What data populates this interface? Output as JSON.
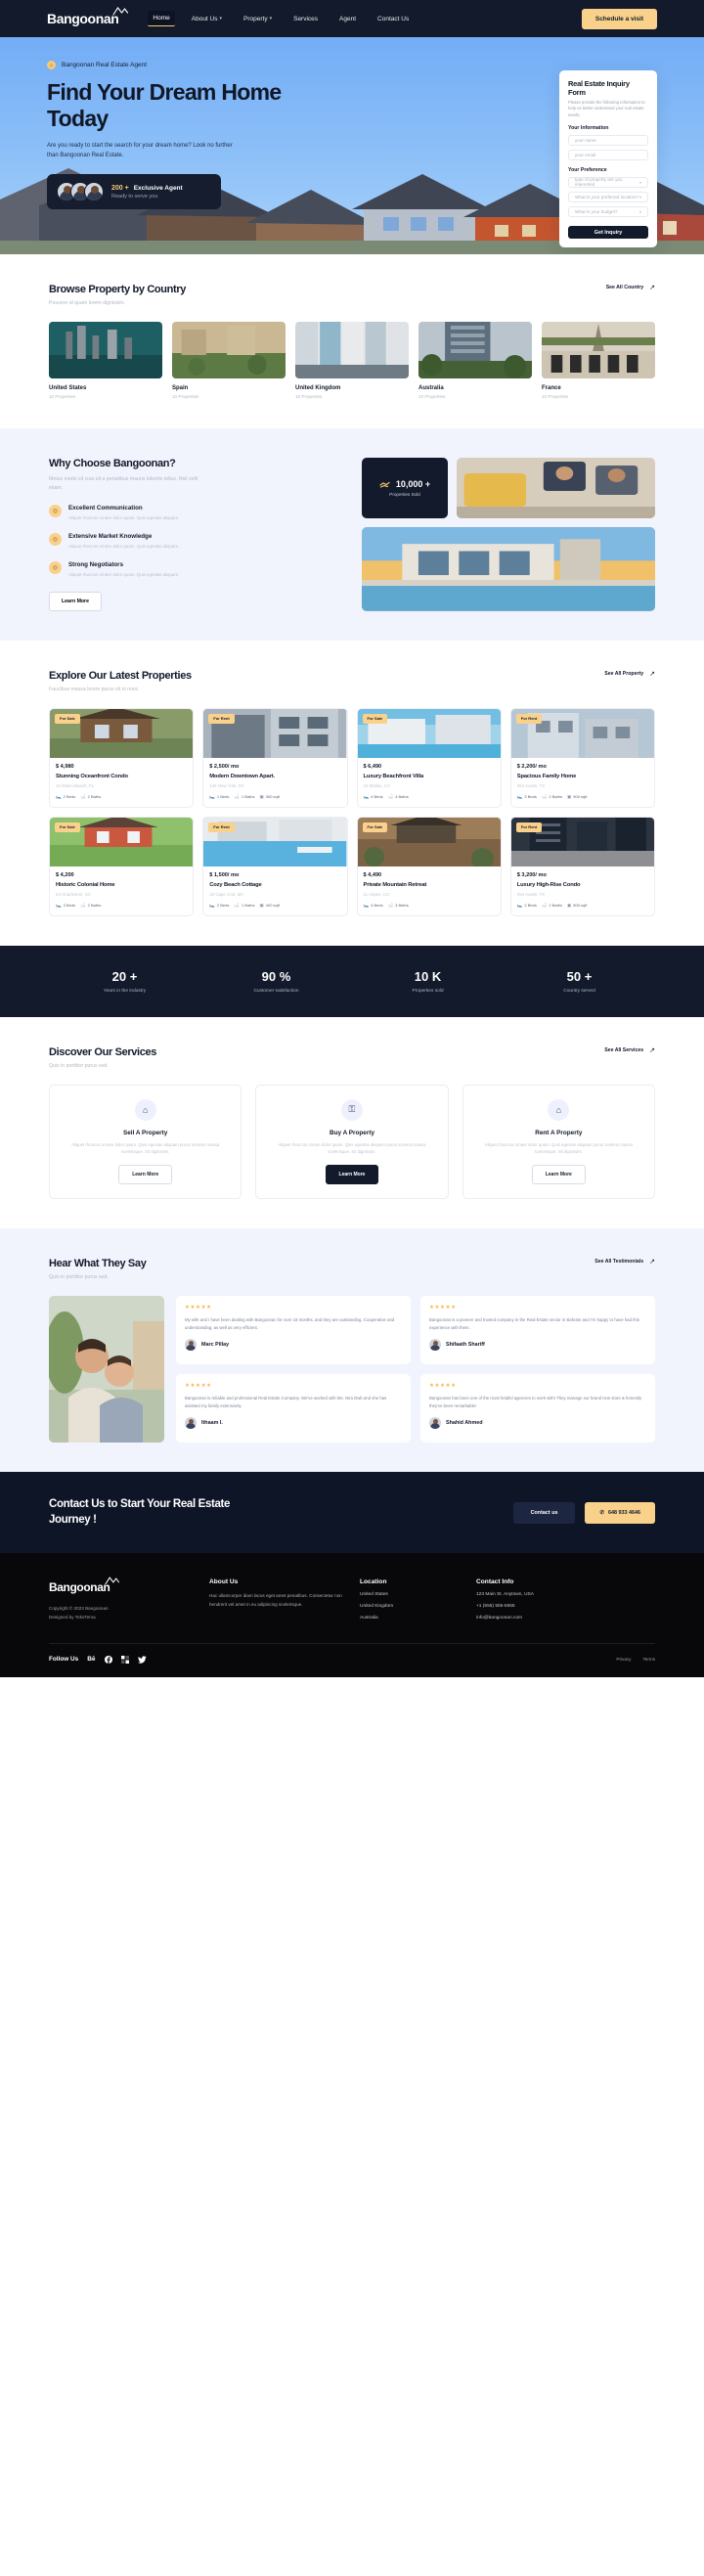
{
  "nav": {
    "brand": "Bangoonan",
    "links": [
      {
        "label": "Home",
        "caret": false,
        "active": true
      },
      {
        "label": "About Us",
        "caret": true,
        "active": false
      },
      {
        "label": "Property",
        "caret": true,
        "active": false
      },
      {
        "label": "Services",
        "caret": false,
        "active": false
      },
      {
        "label": "Agent",
        "caret": false,
        "active": false
      },
      {
        "label": "Contact Us",
        "caret": false,
        "active": false
      }
    ],
    "cta": "Schedule a visit"
  },
  "hero": {
    "badge": "Bangoonan Real Estate Agent",
    "title": "Find Your Dream Home Today",
    "subtitle": "Are you ready to start the search for your dream home? Look no further than Bangoonan Real Estate.",
    "agent_count": "200 +",
    "agent_label": "Exclusive Agent",
    "agent_sub": "Ready to serve you"
  },
  "inquiry": {
    "title": "Real Estate Inquiry Form",
    "description": "Please provide the following information to help us better understand your real estate needs.",
    "group_information": "Your Information",
    "name_placeholder": "your name",
    "email_placeholder": "your email",
    "group_preference": "Your Preference",
    "select_property": "type of property are you interested",
    "select_location": "What is your preferred location?",
    "select_budget": "What is your budget?",
    "submit": "Get Inquiry"
  },
  "country": {
    "title": "Browse Property by Country",
    "subtitle": "Posuere id quam lorem dignissim.",
    "see_all": "See All Country",
    "items": [
      {
        "name": "United States",
        "count": "10 Properties"
      },
      {
        "name": "Spain",
        "count": "10 Properties"
      },
      {
        "name": "United Kingdom",
        "count": "10 Properties"
      },
      {
        "name": "Australia",
        "count": "10 Properties"
      },
      {
        "name": "France",
        "count": "10 Properties"
      }
    ]
  },
  "why": {
    "title": "Why Choose Bangoonan?",
    "lead": "Metus morbi sit cras sit a penatibus mauris lobortis tellus. Nisl velit etiam.",
    "features": [
      {
        "title": "Excellent Communication",
        "desc": "Aliquet rhoncus ornare dolor quam. Quis egestas aliquam."
      },
      {
        "title": "Extensive Market Knowledge",
        "desc": "Aliquet rhoncus ornare dolor quam. Quis egestas aliquam."
      },
      {
        "title": "Strong Negotiators",
        "desc": "Aliquet rhoncus ornare dolor quam. Quis egestas aliquam."
      }
    ],
    "learn_more": "Learn More",
    "sold_number": "10,000 +",
    "sold_label": "Properties Sold"
  },
  "properties": {
    "title": "Explore Our Latest Properties",
    "subtitle": "Faucibus massa lorem purus sit in nunc.",
    "see_all": "See All Property",
    "items": [
      {
        "tag": "For Sale",
        "price": "$ 4,980",
        "name": "Stunning Oceanfront Condo",
        "location": "12 Miami Beach, FL",
        "beds": "2 Beds",
        "baths": "2 Baths",
        "sqft": ""
      },
      {
        "tag": "For Rent",
        "price": "$ 2,500/ mo",
        "name": "Modern Downtown Apart.",
        "location": "146 New York, NY",
        "beds": "1 Beds",
        "baths": "1 Baths",
        "sqft": "300 sqft"
      },
      {
        "tag": "For Sale",
        "price": "$ 6,490",
        "name": "Luxury Beachfront Villa",
        "location": "18 Malibu, CA",
        "beds": "4 Beds",
        "baths": "4 Baths",
        "sqft": ""
      },
      {
        "tag": "For Rent",
        "price": "$ 2,200/ mo",
        "name": "Spacious Family Home",
        "location": "254 Austin, TX",
        "beds": "3 Beds",
        "baths": "2 Baths",
        "sqft": "900 sqft"
      },
      {
        "tag": "For Sale",
        "price": "$ 4,200",
        "name": "Historic Colonial Home",
        "location": "64 Charleston, SC",
        "beds": "3 Beds",
        "baths": "2 Baths",
        "sqft": ""
      },
      {
        "tag": "For Rent",
        "price": "$ 1,500/ mo",
        "name": "Cozy Beach Cottage",
        "location": "22 Cape Cod, MA",
        "beds": "2 Beds",
        "baths": "1 Baths",
        "sqft": "400 sqft"
      },
      {
        "tag": "For Sale",
        "price": "$ 4,490",
        "name": "Private Mountain Retreat",
        "location": "11 Aspen, CO",
        "beds": "4 Beds",
        "baths": "3 Baths",
        "sqft": ""
      },
      {
        "tag": "For Rent",
        "price": "$ 3,200/ mo",
        "name": "Luxury High-Rise Condo",
        "location": "254 Austin, TX",
        "beds": "2 Beds",
        "baths": "2 Baths",
        "sqft": "800 sqft"
      }
    ]
  },
  "stats": [
    {
      "number": "20 +",
      "label": "Years in the industry"
    },
    {
      "number": "90 %",
      "label": "Customer satisfaction"
    },
    {
      "number": "10 K",
      "label": "Properties sold"
    },
    {
      "number": "50 +",
      "label": "Country served"
    }
  ],
  "services": {
    "title": "Discover Our Services",
    "subtitle": "Quis in porttitor purus sed.",
    "see_all": "See All Services",
    "items": [
      {
        "icon": "tag-icon",
        "title": "Sell A Property",
        "desc": "Aliquet rhoncus ornare dolor quam. Quis egestas aliquam purus sceleris massa scelerisque. Sit dignissim.",
        "button": "Learn More",
        "dark": false
      },
      {
        "icon": "key-icon",
        "title": "Buy A Property",
        "desc": "Aliquet rhoncus ornare dolor quam. Quis egestas aliquam purus sceleris massa scelerisque. Sit dignissim.",
        "button": "Learn More",
        "dark": true
      },
      {
        "icon": "home-icon",
        "title": "Rent A Property",
        "desc": "Aliquet rhoncus ornare dolor quam. Quis egestas aliquam purus sceleris massa scelerisque. Sit dignissim.",
        "button": "Learn More",
        "dark": false
      }
    ]
  },
  "testimonials": {
    "title": "Hear What They Say",
    "subtitle": "Quis in porttitor purus sed.",
    "see_all": "See All Testimonials",
    "items": [
      {
        "stars": "★★★★★",
        "quote": "My wife and I have been dealing with Bangoonan for over 18 months, and they are outstanding. Cooperative and understanding, as well as very efficient.",
        "name": "Marc Pillay"
      },
      {
        "stars": "★★★★★",
        "quote": "Bangoonan is a pioneer and trusted company in the Real Estate sector in Bahrain and I'm happy to have had this experience with them.",
        "name": "Shifaath Shariff"
      },
      {
        "stars": "★★★★★",
        "quote": "Bangoonan is reliable and professional Real Estate Company. We've worked with Ms. Nira Dwb and she has assisted my family extensively.",
        "name": "Ithaam I."
      },
      {
        "stars": "★★★★★",
        "quote": "Bangoonan has been one of the most helpful agencies to work with! They manage our brand new store & honestly they've been remarkable!",
        "name": "Shahid Ahmed"
      }
    ]
  },
  "cta": {
    "title": "Contact Us to Start Your Real Estate Journey !",
    "button_contact": "Contact us",
    "button_phone": "648 933 4646"
  },
  "footer": {
    "brand": "Bangoonan",
    "copyright": "Copyright © 2023 Bangoonan",
    "designed": "Designed by TokoTema",
    "about_title": "About Us",
    "about_text": "Hac ullamcorper diam lacus eget amet penatibus. Consectetur non hendrerit vel amet in eu adipiscing scelerisque.",
    "location_title": "Location",
    "locations": [
      "United States",
      "United Kingdom",
      "Australia"
    ],
    "contact_title": "Contact Info",
    "contacts": [
      "123 Main St. Anytown, USA",
      "+1 (555) 555-5555",
      "info@bangoonan.com"
    ],
    "follow": "Follow Us",
    "socials": [
      "behance-icon",
      "facebook-icon",
      "dribbble-icon",
      "twitter-icon"
    ],
    "privacy": "Privacy",
    "terms": "Terms"
  }
}
